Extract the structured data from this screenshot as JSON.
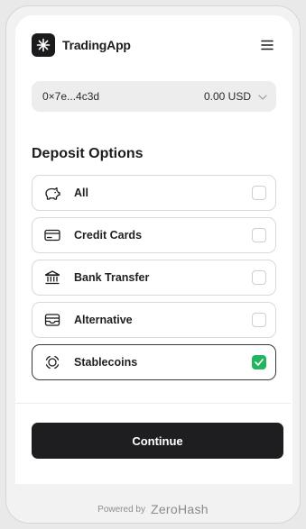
{
  "header": {
    "app_name": "TradingApp",
    "logo_icon": "asterisk-logo-icon",
    "menu_icon": "hamburger-menu-icon"
  },
  "wallet": {
    "address": "0×7e...4c3d",
    "balance": "0.00 USD",
    "chevron_icon": "chevron-down-icon"
  },
  "deposit": {
    "title": "Deposit Options",
    "options": [
      {
        "label": "All",
        "icon": "piggy-bank-icon",
        "checked": false
      },
      {
        "label": "Credit Cards",
        "icon": "credit-card-icon",
        "checked": false
      },
      {
        "label": "Bank Transfer",
        "icon": "bank-icon",
        "checked": false
      },
      {
        "label": "Alternative",
        "icon": "wallet-icon",
        "checked": false
      },
      {
        "label": "Stablecoins",
        "icon": "stablecoin-icon",
        "checked": true
      }
    ]
  },
  "actions": {
    "continue_label": "Continue"
  },
  "footer": {
    "powered_by": "Powered by",
    "provider": "ZeroHash"
  },
  "colors": {
    "primary": "#1e1e20",
    "check_green": "#22b45e",
    "wallet_bg": "#ededee"
  }
}
